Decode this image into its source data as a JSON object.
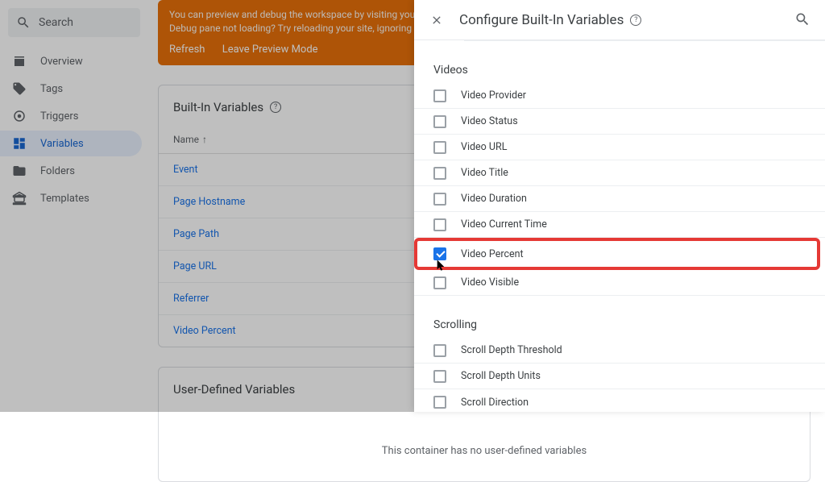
{
  "search": {
    "placeholder": "Search"
  },
  "nav": {
    "overview": "Overview",
    "tags": "Tags",
    "triggers": "Triggers",
    "variables": "Variables",
    "folders": "Folders",
    "templates": "Templates"
  },
  "banner": {
    "line1": "You can preview and debug the workspace by visiting your site",
    "line2": "Debug pane not loading? Try reloading your site, ignoring cached",
    "refresh": "Refresh",
    "leave": "Leave Preview Mode"
  },
  "builtin": {
    "title": "Built-In Variables",
    "col_name": "Name",
    "rows": [
      "Event",
      "Page Hostname",
      "Page Path",
      "Page URL",
      "Referrer",
      "Video Percent"
    ]
  },
  "udv": {
    "title": "User-Defined Variables",
    "empty": "This container has no user-defined variables"
  },
  "panel": {
    "title": "Configure Built-In Variables",
    "sections": {
      "videos": {
        "label": "Videos",
        "items": [
          {
            "label": "Video Provider",
            "checked": false
          },
          {
            "label": "Video Status",
            "checked": false
          },
          {
            "label": "Video URL",
            "checked": false
          },
          {
            "label": "Video Title",
            "checked": false
          },
          {
            "label": "Video Duration",
            "checked": false
          },
          {
            "label": "Video Current Time",
            "checked": false
          },
          {
            "label": "Video Percent",
            "checked": true,
            "highlighted": true
          },
          {
            "label": "Video Visible",
            "checked": false
          }
        ]
      },
      "scrolling": {
        "label": "Scrolling",
        "items": [
          {
            "label": "Scroll Depth Threshold",
            "checked": false
          },
          {
            "label": "Scroll Depth Units",
            "checked": false
          },
          {
            "label": "Scroll Direction",
            "checked": false
          }
        ]
      }
    }
  }
}
